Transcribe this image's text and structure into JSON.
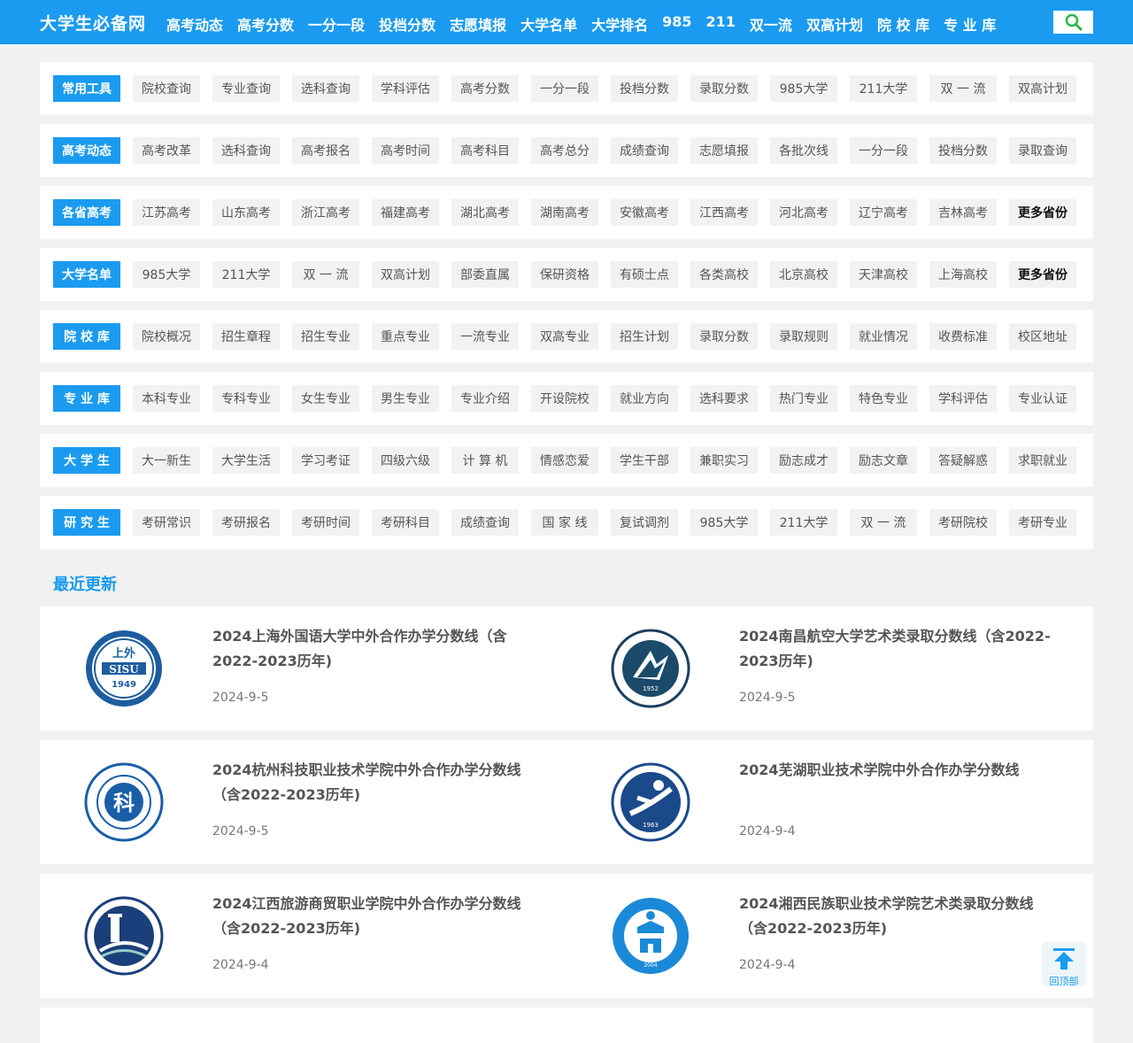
{
  "header": {
    "logo": "大学生必备网",
    "nav": [
      "高考动态",
      "高考分数",
      "一分一段",
      "投档分数",
      "志愿填报",
      "大学名单",
      "大学排名",
      "985",
      "211",
      "双一流",
      "双高计划",
      "院 校 库",
      "专 业 库"
    ]
  },
  "rows": [
    {
      "title": "常用工具",
      "tags": [
        "院校查询",
        "专业查询",
        "选科查询",
        "学科评估",
        "高考分数",
        "一分一段",
        "投档分数",
        "录取分数",
        "985大学",
        "211大学",
        "双 一 流",
        "双高计划"
      ]
    },
    {
      "title": "高考动态",
      "tags": [
        "高考改革",
        "选科查询",
        "高考报名",
        "高考时间",
        "高考科目",
        "高考总分",
        "成绩查询",
        "志愿填报",
        "各批次线",
        "一分一段",
        "投档分数",
        "录取查询"
      ]
    },
    {
      "title": "各省高考",
      "tags": [
        "江苏高考",
        "山东高考",
        "浙江高考",
        "福建高考",
        "湖北高考",
        "湖南高考",
        "安徽高考",
        "江西高考",
        "河北高考",
        "辽宁高考",
        "吉林高考",
        "更多省份"
      ]
    },
    {
      "title": "大学名单",
      "tags": [
        "985大学",
        "211大学",
        "双 一 流",
        "双高计划",
        "部委直属",
        "保研资格",
        "有硕士点",
        "各类高校",
        "北京高校",
        "天津高校",
        "上海高校",
        "更多省份"
      ]
    },
    {
      "title": "院 校 库",
      "tags": [
        "院校概况",
        "招生章程",
        "招生专业",
        "重点专业",
        "一流专业",
        "双高专业",
        "招生计划",
        "录取分数",
        "录取规则",
        "就业情况",
        "收费标准",
        "校区地址"
      ]
    },
    {
      "title": "专 业 库",
      "tags": [
        "本科专业",
        "专科专业",
        "女生专业",
        "男生专业",
        "专业介绍",
        "开设院校",
        "就业方向",
        "选科要求",
        "热门专业",
        "特色专业",
        "学科评估",
        "专业认证"
      ]
    },
    {
      "title": "大 学 生",
      "tags": [
        "大一新生",
        "大学生活",
        "学习考证",
        "四级六级",
        "计 算 机",
        "情感恋爱",
        "学生干部",
        "兼职实习",
        "励志成才",
        "励志文章",
        "答疑解惑",
        "求职就业"
      ]
    },
    {
      "title": "研 究 生",
      "tags": [
        "考研常识",
        "考研报名",
        "考研时间",
        "考研科目",
        "成绩查询",
        "国 家 线",
        "复试调剂",
        "985大学",
        "211大学",
        "双 一 流",
        "考研院校",
        "考研专业"
      ]
    }
  ],
  "recent": {
    "title": "最近更新",
    "items": [
      {
        "title": "2024上海外国语大学中外合作办学分数线（含2022-2023历年)",
        "date": "2024-9-5",
        "logo_text": "上外 SISU 1949"
      },
      {
        "title": "2024南昌航空大学艺术类录取分数线（含2022-2023历年)",
        "date": "2024-9-5",
        "logo_text": "1952"
      },
      {
        "title": "2024杭州科技职业技术学院中外合作办学分数线（含2022-2023历年)",
        "date": "2024-9-5",
        "logo_text": "科"
      },
      {
        "title": "2024芜湖职业技术学院中外合作办学分数线",
        "date": "2024-9-4",
        "logo_text": "1963"
      },
      {
        "title": "2024江西旅游商贸职业学院中外合作办学分数线（含2022-2023历年)",
        "date": "2024-9-4",
        "logo_text": ""
      },
      {
        "title": "2024湘西民族职业技术学院艺术类录取分数线（含2022-2023历年)",
        "date": "2024-9-4",
        "logo_text": "2004"
      }
    ]
  },
  "back_top": "回顶部",
  "colors": {
    "primary": "#1a9bf0",
    "tag_bg": "#f2f2f2",
    "page_bg": "#f1f1f1"
  }
}
